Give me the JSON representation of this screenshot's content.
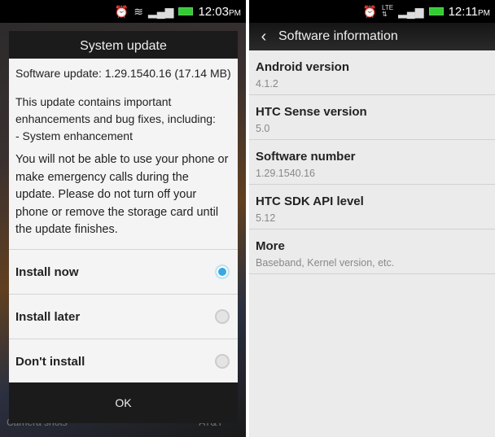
{
  "left": {
    "status": {
      "time": "12:03",
      "ampm": "PM",
      "icons": [
        "alarm-icon",
        "wifi-icon",
        "signal-icon",
        "battery-icon"
      ]
    },
    "dialog": {
      "title": "System update",
      "version_line": "Software update: 1.29.1540.16 (17.14 MB)",
      "desc": "This update contains important enhancements and bug fixes, including:",
      "bullet": "- System enhancement",
      "warning": "You will not be able to use your phone or make emergency calls during the update. Please do not turn off your phone or remove the storage card until the update finishes.",
      "options": [
        {
          "label": "Install now",
          "selected": true
        },
        {
          "label": "Install later",
          "selected": false
        },
        {
          "label": "Don't install",
          "selected": false
        }
      ],
      "ok_label": "OK"
    },
    "background": {
      "left_text": "Camera shots",
      "right_text": "AT&T"
    }
  },
  "right": {
    "status": {
      "time": "12:11",
      "ampm": "PM",
      "icons": [
        "alarm-icon",
        "lte-icon",
        "signal-icon",
        "battery-icon"
      ]
    },
    "header": {
      "title": "Software information"
    },
    "items": [
      {
        "title": "Android version",
        "value": "4.1.2"
      },
      {
        "title": "HTC Sense version",
        "value": "5.0"
      },
      {
        "title": "Software number",
        "value": "1.29.1540.16"
      },
      {
        "title": "HTC SDK API level",
        "value": "5.12"
      },
      {
        "title": "More",
        "value": "Baseband, Kernel version, etc."
      }
    ]
  },
  "colors": {
    "accent": "#3aa8e0"
  }
}
